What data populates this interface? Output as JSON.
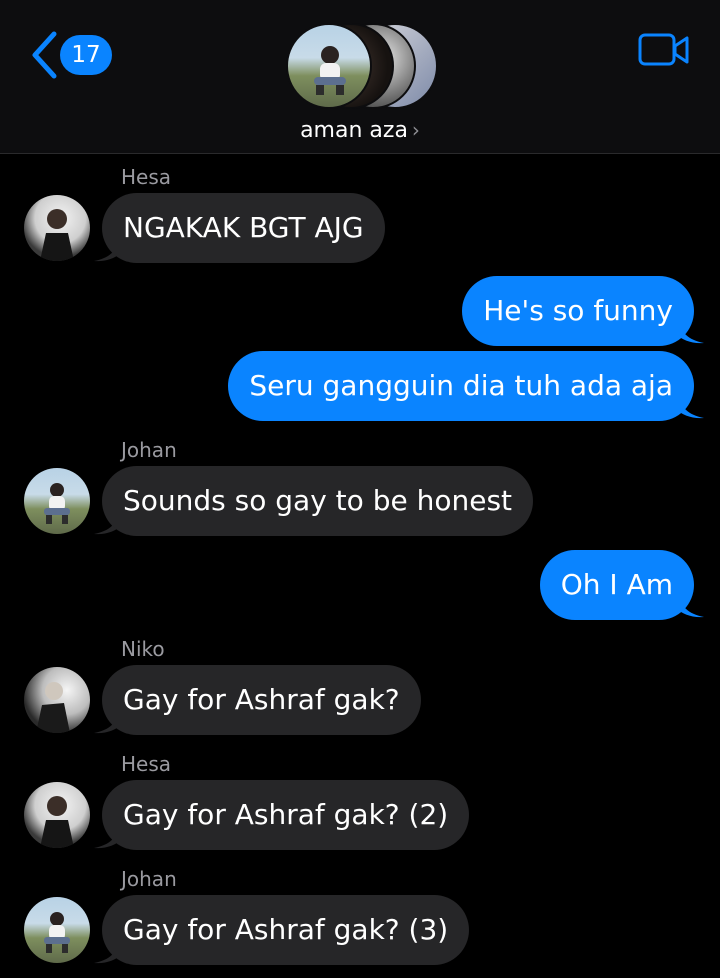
{
  "header": {
    "back_count": "17",
    "group_title": "aman aza",
    "title_chevron": "›",
    "icons": {
      "back": "chevron-left-icon",
      "video": "video-camera-icon"
    }
  },
  "colors": {
    "accent": "#0a84ff",
    "incoming_bubble": "#262628",
    "background": "#000000"
  },
  "messages": [
    {
      "sender": "Hesa",
      "text": "NGAKAK BGT AJG",
      "direction": "incoming"
    },
    {
      "text": "He's so funny",
      "direction": "outgoing"
    },
    {
      "text": "Seru gangguin dia tuh ada aja",
      "direction": "outgoing"
    },
    {
      "sender": "Johan",
      "text": "Sounds so gay to be honest",
      "direction": "incoming"
    },
    {
      "text": "Oh I Am",
      "direction": "outgoing"
    },
    {
      "sender": "Niko",
      "text": "Gay for Ashraf gak?",
      "direction": "incoming"
    },
    {
      "sender": "Hesa",
      "text": "Gay for Ashraf gak? (2)",
      "direction": "incoming"
    },
    {
      "sender": "Johan",
      "text": "Gay for Ashraf gak? (3)",
      "direction": "incoming"
    }
  ]
}
